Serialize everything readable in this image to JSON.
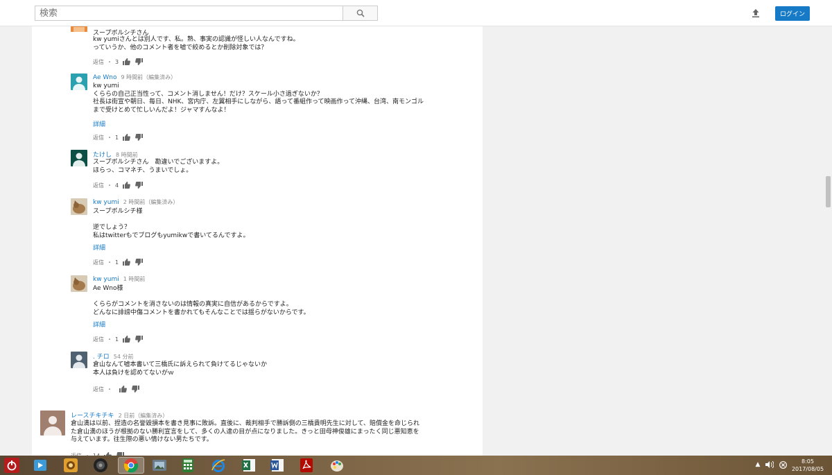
{
  "header": {
    "search_placeholder": "検索",
    "login_label": "ログイン"
  },
  "comments": [
    {
      "author": "スープボルシチさん",
      "time": "",
      "lines": "kw yumiさんとは別人です、私。熟、事実の認識が怪しい人なんですね。\nっていうか、他のコメント者を嘘で絞めるとか削除対象では？",
      "more": "",
      "reply_label": "返信",
      "likes": "3"
    },
    {
      "author": "Ae Wno",
      "time": "9 時間前（編集済み）",
      "lines": "kw yumi\nくららの自己正当性って、コメント消しません！だけ？スケール小さ過ぎないか？\n社長は街宣や朝日、毎日、NHK、宮内庁、左翼相手にしながら、語って番組作って映画作って沖縄、台湾、南モンゴル\nまで受けとめて忙しいんだよ！ジャマすんなよ！",
      "more": "詳細",
      "reply_label": "返信",
      "likes": "1"
    },
    {
      "author": "たけし",
      "time": "8 時間前",
      "lines": "スープボルシチさん　勘違いでございますよ。\nほらっ、コマネチ、うまいでしょ。",
      "more": "",
      "reply_label": "返信",
      "likes": "4"
    },
    {
      "author": "kw yumi",
      "time": "2 時間前（編集済み）",
      "lines": "スープボルシチ様\n\n逆でしょう？\n私はtwitterもでブログもyumikwで書いてるんですよ。",
      "more": "詳細",
      "reply_label": "返信",
      "likes": "1"
    },
    {
      "author": "kw yumi",
      "time": "1 時間前",
      "lines": "Ae Wno様\n\nくららがコメントを消さないのは情報の真実に自信があるからですよ。\nどんなに誹謗中傷コメントを書かれてもそんなことでは揺らがないからです。",
      "more": "詳細",
      "reply_label": "返信",
      "likes": "1"
    },
    {
      "author": ". チロ",
      "time": "54 分前",
      "lines": "倉山なんて嘘本書いて三橋氏に訴えられて負けてるじゃないか\n本人は負けを認めてないがｗ",
      "more": "",
      "reply_label": "返信",
      "likes": ""
    },
    {
      "author": "レースチキチキ",
      "time": "2 日前（編集済み）",
      "lines": "倉山満は以前、捏造の名誉毀損本を書き見事に敗訴。直後に、裁判相手で勝訴側の三橋貴明先生に対して、賠償金を命じられ\nた倉山満のほうが根拠のない勝利宣言をして、多くの人達の目が点になりました。きっと田母神俊雄にまったく同じ悪知恵を\n与えています。往生際の悪い情けない男たちです。",
      "more": "",
      "reply_label": "返信",
      "likes": "14"
    }
  ],
  "taskbar": {
    "apps": [
      "power-app",
      "media-player-app",
      "game-app",
      "speaker-app",
      "chrome-app",
      "photo-app",
      "calculator-app",
      "ie-app",
      "excel-app",
      "word-app",
      "acrobat-app",
      "paint-app"
    ],
    "clock_time": "8:05",
    "clock_date": "2017/08/05"
  },
  "colors": {
    "link": "#167ac6",
    "login_bg": "#167ac6"
  }
}
